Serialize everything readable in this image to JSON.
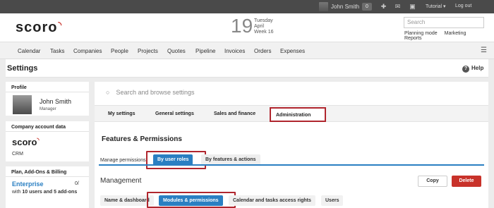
{
  "topbar": {
    "user_name": "John Smith",
    "notif_count": "0",
    "tutorial_label": "Tutorial ▾",
    "logout_label": "Log out"
  },
  "header": {
    "logo": "scoro",
    "date_day": "19",
    "date_weekday": "Tuesday",
    "date_month": "April",
    "date_week": "Week 16",
    "search_placeholder": "Search",
    "links": [
      "Planning mode",
      "Marketing",
      "Reports"
    ]
  },
  "nav": {
    "items": [
      "Calendar",
      "Tasks",
      "Companies",
      "People",
      "Projects",
      "Quotes",
      "Pipeline",
      "Invoices",
      "Orders",
      "Expenses"
    ]
  },
  "settings": {
    "title": "Settings",
    "help_label": "Help"
  },
  "profile": {
    "title": "Profile",
    "name": "John Smith",
    "role": "Manager"
  },
  "company": {
    "title": "Company account data",
    "logo": "scoro",
    "product": "CRM"
  },
  "plan": {
    "title": "Plan, Add-Ons & Billing",
    "name": "Enterprise",
    "fraction": "0/",
    "desc_prefix": "with ",
    "desc_bold": "10 users and 5 add-ons"
  },
  "main": {
    "search_placeholder": "Search and browse settings",
    "tabs": [
      "My settings",
      "General settings",
      "Sales and finance",
      "Administration"
    ],
    "section_title": "Features & Permissions",
    "manage_label": "Manage permissions",
    "by_user_roles": "By user roles",
    "by_features": "By features & actions",
    "management_title": "Management",
    "copy_label": "Copy",
    "delete_label": "Delete",
    "subtabs": [
      "Name & dashboard",
      "Modules & permissions",
      "Calendar and tasks access rights",
      "Users"
    ]
  }
}
